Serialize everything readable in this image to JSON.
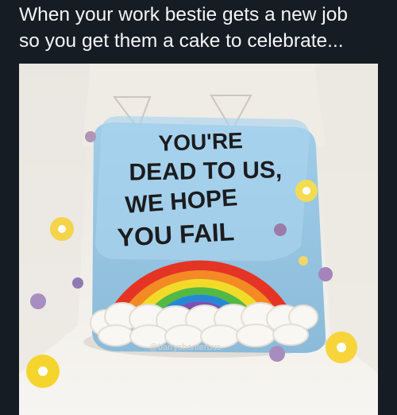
{
  "post": {
    "caption_line1": "When your work bestie gets a new job",
    "caption_line2": "so you get them a cake to celebrate..."
  },
  "photo": {
    "subject": "cake-in-box-photo",
    "cake_text": {
      "line1": "YOU'RE",
      "line2": "DEAD TO US,",
      "line3": "WE HOPE",
      "line4": "YOU FAIL"
    },
    "watermark": "@barrysbanterbus",
    "colors": {
      "frosting": "#a9d3ee",
      "box": "#f3f0ea",
      "lettering": "#1b1c1e"
    }
  }
}
